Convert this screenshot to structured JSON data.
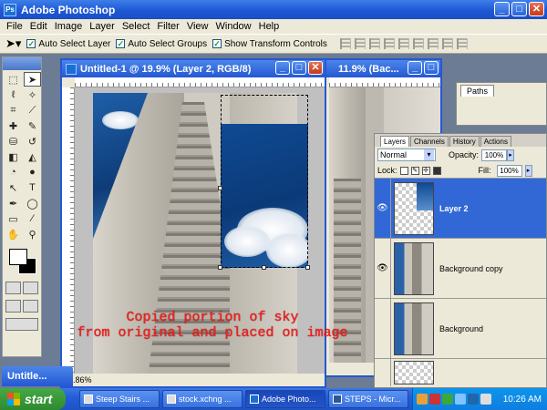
{
  "window": {
    "title": "Adobe Photoshop",
    "logo_text": "Ps"
  },
  "window_buttons": {
    "minimize": "_",
    "maximize": "□",
    "close": "✕"
  },
  "menu": [
    "File",
    "Edit",
    "Image",
    "Layer",
    "Select",
    "Filter",
    "View",
    "Window",
    "Help"
  ],
  "options_bar": {
    "tool_icon": "move-arrow-icon",
    "auto_select_layer": "Auto Select Layer",
    "auto_select_groups": "Auto Select Groups",
    "show_transform_controls": "Show Transform Controls"
  },
  "document_front": {
    "title": "Untitled-1 @ 19.9% (Layer 2, RGB/8)",
    "zoom_status": "19.86%"
  },
  "document_back": {
    "title": "11.9% (Bac..."
  },
  "minimized_doc": {
    "title": "Untitle..."
  },
  "annotation": {
    "line1": "Copied portion of sky",
    "line2": "from original and placed on image"
  },
  "paths_panel": {
    "tab": "Paths"
  },
  "layers_panel": {
    "tabs": [
      "Layers",
      "Channels",
      "History",
      "Actions"
    ],
    "blend_mode": "Normal",
    "opacity_label": "Opacity:",
    "opacity_value": "100%",
    "lock_label": "Lock:",
    "fill_label": "Fill:",
    "fill_value": "100%",
    "layers": [
      {
        "name": "Layer 2",
        "visible": true,
        "selected": true
      },
      {
        "name": "Background copy",
        "visible": true,
        "selected": false
      },
      {
        "name": "Background",
        "visible": false,
        "selected": false
      }
    ]
  },
  "taskbar": {
    "start_label": "start",
    "tasks": [
      {
        "label": "Steep Stairs ...",
        "active": false
      },
      {
        "label": "stock.xchng ...",
        "active": false
      },
      {
        "label": "Adobe Photo...",
        "active": true
      },
      {
        "label": "STEPS - Micr...",
        "active": false
      }
    ],
    "clock": "10:26 AM"
  },
  "colors": {
    "xp_blue": "#2458d2",
    "annotation_red": "#ff1a1a",
    "layer_selected": "#3168d5",
    "start_green": "#3a9a3a"
  }
}
